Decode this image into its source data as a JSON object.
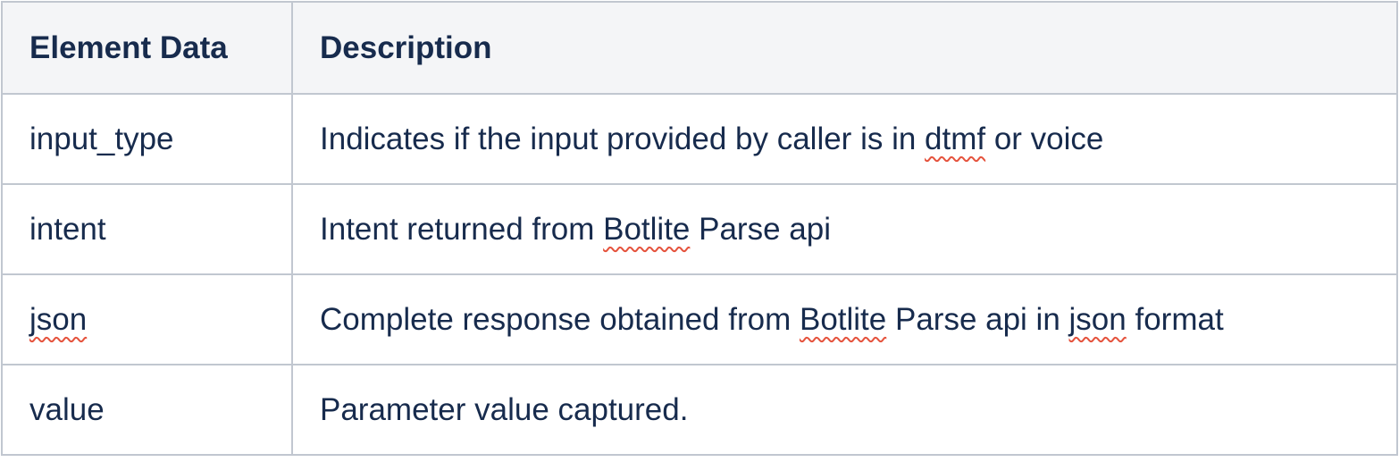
{
  "table": {
    "headers": [
      "Element Data",
      "Description"
    ],
    "rows": [
      {
        "element": "input_type",
        "description": [
          {
            "t": "Indicates if the input provided by caller is in ",
            "s": false
          },
          {
            "t": "dtmf",
            "s": true
          },
          {
            "t": " or voice",
            "s": false
          }
        ]
      },
      {
        "element": "intent",
        "description": [
          {
            "t": "Intent returned from ",
            "s": false
          },
          {
            "t": "Botlite",
            "s": true
          },
          {
            "t": " Parse api",
            "s": false
          }
        ]
      },
      {
        "element": "json",
        "element_spell": true,
        "description": [
          {
            "t": "Complete response obtained from ",
            "s": false
          },
          {
            "t": "Botlite",
            "s": true
          },
          {
            "t": " Parse api in ",
            "s": false
          },
          {
            "t": "json",
            "s": true
          },
          {
            "t": " format",
            "s": false
          }
        ]
      },
      {
        "element": "value",
        "description": [
          {
            "t": "Parameter value captured.",
            "s": false
          }
        ]
      }
    ]
  },
  "colors": {
    "text": "#172b4d",
    "header_bg": "#f4f5f7",
    "border": "#c1c7d0",
    "spellcheck_underline": "#e5533d"
  }
}
